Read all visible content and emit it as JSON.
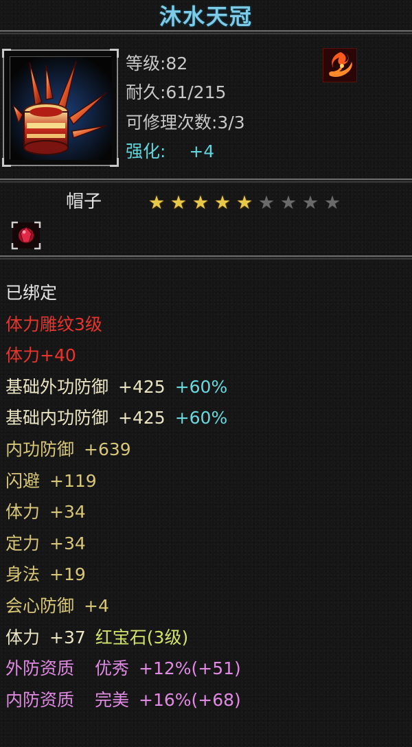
{
  "item": {
    "name": "沐水天冠",
    "level": "等级:82",
    "durability": "耐久:61/215",
    "repair": "可修理次数:3/3",
    "enhance_label": "强化:",
    "enhance_value": "+4",
    "type": "帽子",
    "stars_total": 9,
    "stars_lit": 5,
    "element_icon": "fire-swirl-icon",
    "gem_slot_icon": "red-gem-slot-icon"
  },
  "properties": [
    {
      "text": "已绑定",
      "color": "white"
    },
    {
      "text": "体力雕纹3级",
      "color": "red"
    },
    {
      "text": "体力+40",
      "color": "red"
    },
    {
      "label": "基础外功防御",
      "value": "+425",
      "extra": "+60%"
    },
    {
      "label": "基础内功防御",
      "value": "+425",
      "extra": "+60%"
    },
    {
      "label": "内功防御",
      "value": "+639"
    },
    {
      "label": "闪避",
      "value": "+119"
    },
    {
      "label": "体力",
      "value": "+34"
    },
    {
      "label": "定力",
      "value": "+34"
    },
    {
      "label": "身法",
      "value": "+19"
    },
    {
      "label": "会心防御",
      "value": "+4"
    },
    {
      "label": "体力",
      "value": "+37",
      "extra": "红宝石(3级)"
    },
    {
      "label": "外防资质",
      "grade": "优秀",
      "value": "+12%(+51)"
    },
    {
      "label": "内防资质",
      "grade": "完美",
      "value": "+16%(+68)"
    }
  ],
  "colors": {
    "title": "#7ecbe8",
    "star_on": "#e8c84a",
    "star_off": "#6a6a6a",
    "enhance": "#5fd6dc",
    "bound": "#e6e6e6",
    "engrave": "#e8342c",
    "base_label": "#ece5c4",
    "attr_label": "#d8c776",
    "percent": "#68d9df",
    "gem": "#d4e46a",
    "quality": "#e18ae4"
  }
}
